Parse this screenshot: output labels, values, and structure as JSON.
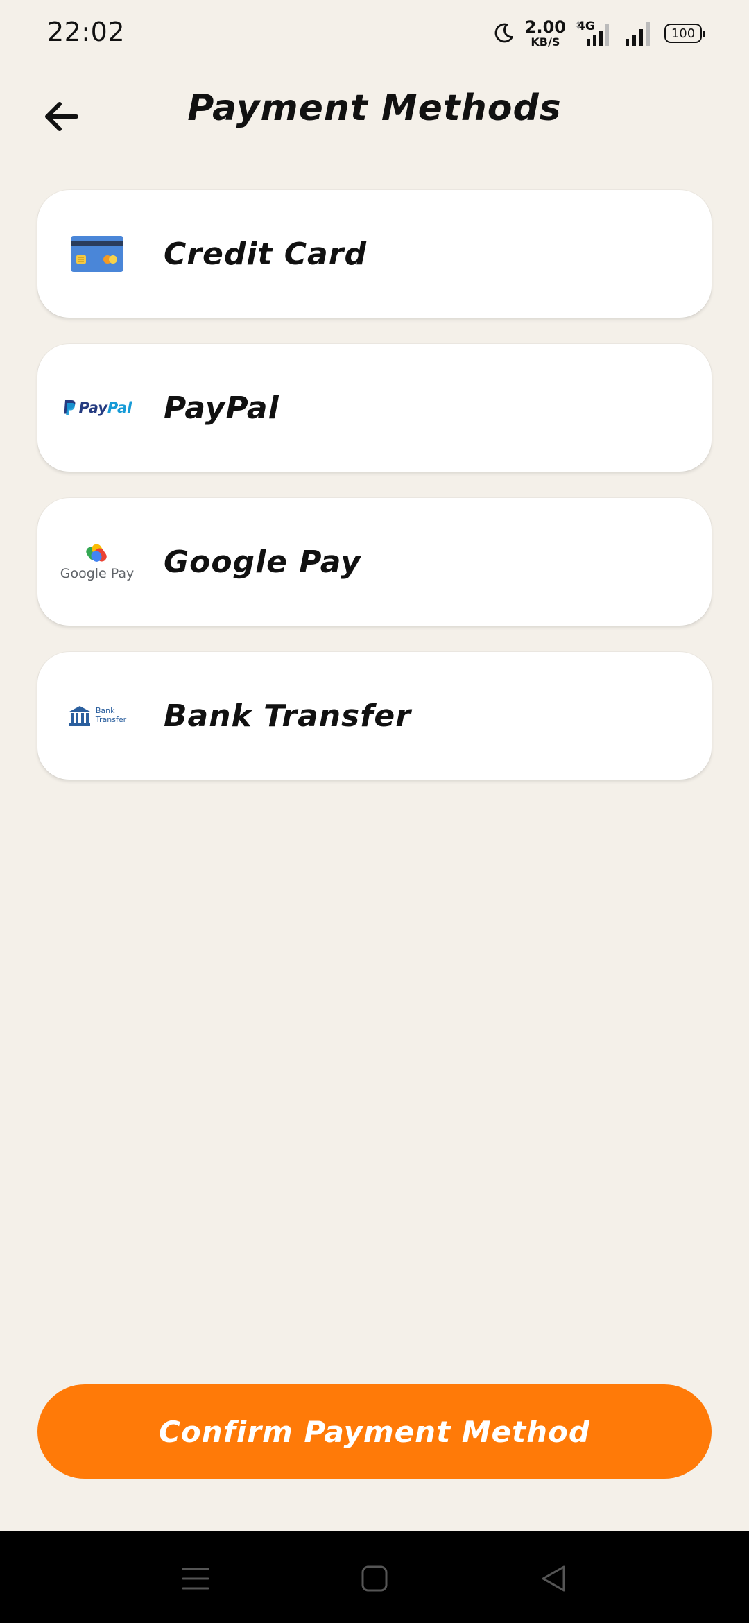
{
  "status_bar": {
    "time": "22:02",
    "net_speed_value": "2.00",
    "net_speed_unit": "KB/S",
    "network_type": "4G",
    "battery": "100"
  },
  "header": {
    "title": "Payment Methods"
  },
  "payment_methods": [
    {
      "label": "Credit Card",
      "icon": "credit-card-icon"
    },
    {
      "label": "PayPal",
      "icon": "paypal-logo",
      "logo_text_1": "Pay",
      "logo_text_2": "Pal"
    },
    {
      "label": "Google Pay",
      "icon": "google-pay-logo",
      "logo_text": "Google Pay"
    },
    {
      "label": "Bank Transfer",
      "icon": "bank-icon",
      "logo_text_1": "Bank",
      "logo_text_2": "Transfer"
    }
  ],
  "confirm_button": {
    "label": "Confirm Payment Method"
  },
  "colors": {
    "background": "#f4f0e9",
    "card": "#ffffff",
    "accent": "#ff7a08",
    "nav_bar": "#000000"
  }
}
